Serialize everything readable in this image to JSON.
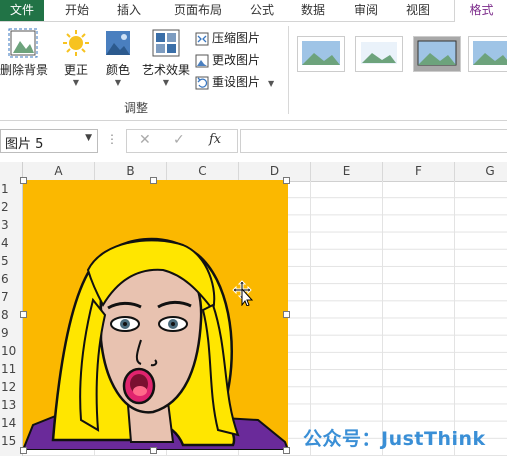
{
  "ribbon_tabs": [
    {
      "label": "文件"
    },
    {
      "label": "开始"
    },
    {
      "label": "插入"
    },
    {
      "label": "页面布局"
    },
    {
      "label": "公式"
    },
    {
      "label": "数据"
    },
    {
      "label": "审阅"
    },
    {
      "label": "视图"
    },
    {
      "label": "格式"
    }
  ],
  "ribbon": {
    "remove_bg": "删除背景",
    "corrections": "更正",
    "color": "颜色",
    "artistic": "艺术效果",
    "compress": "压缩图片",
    "change": "更改图片",
    "reset": "重设图片",
    "group_adjust": "调整"
  },
  "formula_bar": {
    "name_box": "图片 5",
    "cancel": "✕",
    "enter": "✓",
    "fx": "fx",
    "formula": ""
  },
  "columns": [
    "A",
    "B",
    "C",
    "D",
    "E",
    "F",
    "G"
  ],
  "rows": [
    "1",
    "2",
    "3",
    "4",
    "5",
    "6",
    "7",
    "8",
    "9",
    "10",
    "11",
    "12",
    "13",
    "14",
    "15"
  ],
  "watermark": "公众号：JustThink",
  "colors": {
    "file_tab": "#217346",
    "format_tab": "#7b2a8a",
    "picture_bg": "#fbb800",
    "hair": "#ffea00"
  }
}
